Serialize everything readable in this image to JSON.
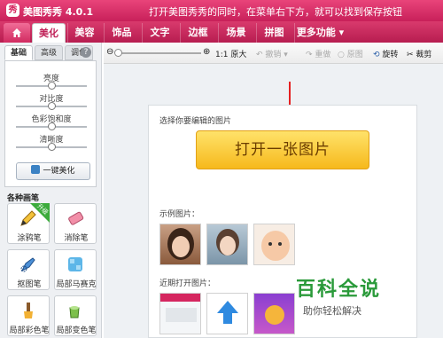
{
  "titlebar": {
    "app_title": "美图秀秀 4.0.1",
    "banner_text": "打开美图秀秀的同时，在菜单右下方，就可以找到保存按钮"
  },
  "main_tabs": [
    "美化",
    "美容",
    "饰品",
    "文字",
    "边框",
    "场景",
    "拼图",
    "更多功能"
  ],
  "toolbar": {
    "original_size": "1:1 原大",
    "undo": "撤销",
    "redo": "重做",
    "restore": "原图",
    "rotate": "旋转",
    "crop": "裁剪"
  },
  "left_panel": {
    "subtabs": [
      "基础",
      "高级",
      "调色"
    ],
    "adjustments": [
      {
        "label": "亮度",
        "value": 0.5
      },
      {
        "label": "对比度",
        "value": 0.5
      },
      {
        "label": "色彩饱和度",
        "value": 0.5
      },
      {
        "label": "清晰度",
        "value": 0.5
      }
    ],
    "one_click_button": "一键美化",
    "brush_section_title": "各种画笔",
    "brushes": [
      {
        "label": "涂鸦笔",
        "icon": "pencil-icon",
        "badge": "升级"
      },
      {
        "label": "消除笔",
        "icon": "eraser-icon"
      },
      {
        "label": "抠图笔",
        "icon": "cutout-pen-icon"
      },
      {
        "label": "局部马赛克",
        "icon": "mosaic-icon"
      },
      {
        "label": "局部彩色笔",
        "icon": "color-brush-icon"
      },
      {
        "label": "局部变色笔",
        "icon": "paint-bucket-icon"
      }
    ]
  },
  "canvas": {
    "select_prompt": "选择你要编辑的图片",
    "open_button": "打开一张图片",
    "sample_label": "示例图片：",
    "recent_label": "近期打开图片："
  },
  "watermark": {
    "title": "百科全说",
    "subtitle": "助你轻松解决"
  },
  "colors": {
    "brand_pink": "#d5265f",
    "open_button_yellow": "#f6b91c",
    "arrow_red": "#e52020",
    "watermark_green": "#2a9a3a"
  }
}
